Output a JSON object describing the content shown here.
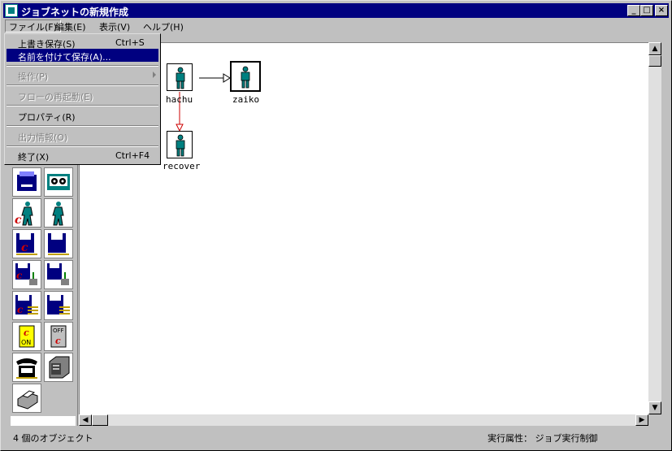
{
  "window": {
    "title": "ジョブネットの新規作成"
  },
  "title_buttons": {
    "minimize": "_",
    "maximize": "□",
    "close": "×"
  },
  "menubar": [
    {
      "label": "ファイル(F)"
    },
    {
      "label": "編集(E)"
    },
    {
      "label": "表示(V)"
    },
    {
      "label": "ヘルプ(H)"
    }
  ],
  "file_menu": [
    {
      "label": "上書き保存(S)",
      "shortcut": "Ctrl+S"
    },
    {
      "label": "名前を付けて保存(A)...",
      "shortcut": ""
    },
    {
      "label": "操作(P)",
      "shortcut": ""
    },
    {
      "label": "フローの再起動(E)",
      "shortcut": ""
    },
    {
      "label": "プロパティ(R)",
      "shortcut": ""
    },
    {
      "label": "出力情報(O)",
      "shortcut": ""
    },
    {
      "label": "終了(X)",
      "shortcut": "Ctrl+F4"
    }
  ],
  "nodes": [
    {
      "label": "hachu"
    },
    {
      "label": "zaiko"
    },
    {
      "label": "recover"
    }
  ],
  "palette": [
    {
      "name": "server-icon"
    },
    {
      "name": "tape-icon"
    },
    {
      "name": "c-job-icon"
    },
    {
      "name": "job-icon"
    },
    {
      "name": "c-file-icon"
    },
    {
      "name": "file-icon"
    },
    {
      "name": "c-file-transfer-icon"
    },
    {
      "name": "file-transfer-icon"
    },
    {
      "name": "c-file-list-icon"
    },
    {
      "name": "file-list-icon"
    },
    {
      "name": "on-switch-icon",
      "text": "ON"
    },
    {
      "name": "off-switch-icon",
      "text": "OFF"
    },
    {
      "name": "telephone-icon"
    },
    {
      "name": "machine-icon"
    },
    {
      "name": "printer-icon"
    }
  ],
  "status": {
    "left": "4 個のオブジェクト",
    "right": "実行属性： ジョブ実行制御"
  },
  "colors": {
    "titlebar": "#000080",
    "highlight": "#000080",
    "figure": "#008080",
    "flow_red": "#cc0000"
  }
}
